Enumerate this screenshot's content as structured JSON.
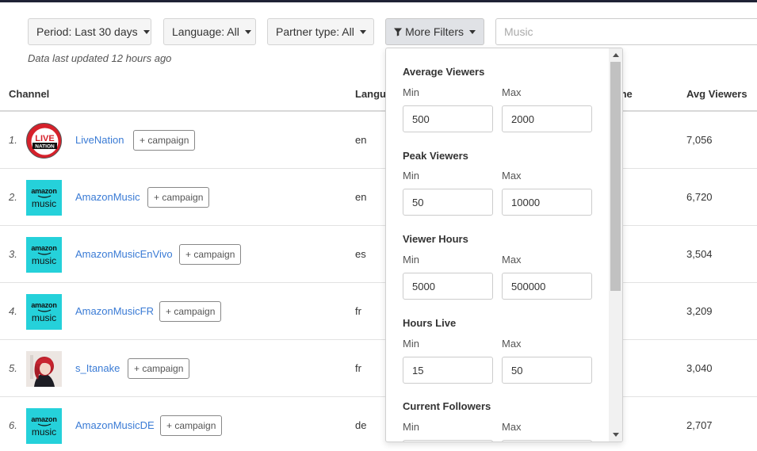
{
  "filters": {
    "period": "Period: Last 30 days",
    "language": "Language: All",
    "partner": "Partner type: All",
    "more": "More Filters",
    "search_placeholder": "Music"
  },
  "updated_text": "Data last updated 12 hours ago",
  "table": {
    "headers": {
      "channel": "Channel",
      "language": "Langu",
      "time_partial": "me",
      "avg_viewers": "Avg Viewers"
    },
    "rows": [
      {
        "rank": "1.",
        "name": "LiveNation",
        "campaign": "+ campaign",
        "language": "en",
        "avg": "7,056",
        "avatar": "livenation-logo"
      },
      {
        "rank": "2.",
        "name": "AmazonMusic",
        "campaign": "+ campaign",
        "language": "en",
        "avg": "6,720",
        "avatar": "amazon-music-logo"
      },
      {
        "rank": "3.",
        "name": "AmazonMusicEnVivo",
        "campaign": "+ campaign",
        "language": "es",
        "avg": "3,504",
        "avatar": "amazon-music-logo"
      },
      {
        "rank": "4.",
        "name": "AmazonMusicFR",
        "campaign": "+ campaign",
        "language": "fr",
        "avg": "3,209",
        "avatar": "amazon-music-logo"
      },
      {
        "rank": "5.",
        "name": "s_Itanake",
        "campaign": "+ campaign",
        "language": "fr",
        "avg": "3,040",
        "avatar": "anime-avatar"
      },
      {
        "rank": "6.",
        "name": "AmazonMusicDE",
        "campaign": "+ campaign",
        "language": "de",
        "avg": "2,707",
        "avatar": "amazon-music-logo"
      }
    ]
  },
  "logos": {
    "live_line1": "LIVE",
    "live_line2": "NATION",
    "amazon_line1": "amazon",
    "amazon_line2": "music"
  },
  "more_filters": {
    "groups": [
      {
        "title": "Average Viewers",
        "min_label": "Min",
        "max_label": "Max",
        "min": "500",
        "max": "2000"
      },
      {
        "title": "Peak Viewers",
        "min_label": "Min",
        "max_label": "Max",
        "min": "50",
        "max": "10000"
      },
      {
        "title": "Viewer Hours",
        "min_label": "Min",
        "max_label": "Max",
        "min": "5000",
        "max": "500000"
      },
      {
        "title": "Hours Live",
        "min_label": "Min",
        "max_label": "Max",
        "min": "15",
        "max": "50"
      },
      {
        "title": "Current Followers",
        "min_label": "Min",
        "max_label": "Max",
        "min": "",
        "max": ""
      }
    ]
  },
  "colors": {
    "link": "#3a7bd5",
    "amazon_bg": "#25d1da",
    "livenation_red": "#d6212b",
    "topbar": "#1f2235"
  }
}
